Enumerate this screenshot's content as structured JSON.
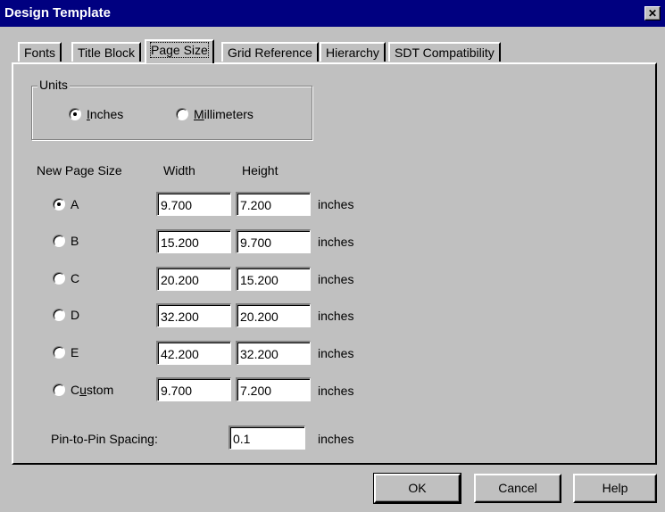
{
  "window": {
    "title": "Design Template",
    "close_glyph": "✕"
  },
  "tabs": [
    {
      "label": "Fonts"
    },
    {
      "label": "Title Block"
    },
    {
      "label": "Page Size",
      "active": true
    },
    {
      "label": "Grid Reference"
    },
    {
      "label": "Hierarchy"
    },
    {
      "label": "SDT Compatibility"
    }
  ],
  "units": {
    "legend": "Units",
    "inches": {
      "pre": "",
      "u": "I",
      "post": "nches",
      "checked": true
    },
    "millimeters": {
      "pre": "",
      "u": "M",
      "post": "illimeters",
      "checked": false
    }
  },
  "page_size": {
    "header": {
      "col1": "New Page Size",
      "col2": "Width",
      "col3": "Height"
    },
    "unit_label": "inches",
    "rows": [
      {
        "label": "A",
        "width": "9.700",
        "height": "7.200",
        "checked": true
      },
      {
        "label": "B",
        "width": "15.200",
        "height": "9.700",
        "checked": false
      },
      {
        "label": "C",
        "width": "20.200",
        "height": "15.200",
        "checked": false
      },
      {
        "label": "D",
        "width": "32.200",
        "height": "20.200",
        "checked": false
      },
      {
        "label": "E",
        "width": "42.200",
        "height": "32.200",
        "checked": false
      }
    ],
    "custom": {
      "pre": "C",
      "u": "u",
      "post": "stom",
      "width": "9.700",
      "height": "7.200",
      "checked": false
    }
  },
  "pin_spacing": {
    "label": "Pin-to-Pin Spacing:",
    "value": "0.1",
    "unit": "inches"
  },
  "buttons": {
    "ok": "OK",
    "cancel": "Cancel",
    "help": "Help"
  }
}
